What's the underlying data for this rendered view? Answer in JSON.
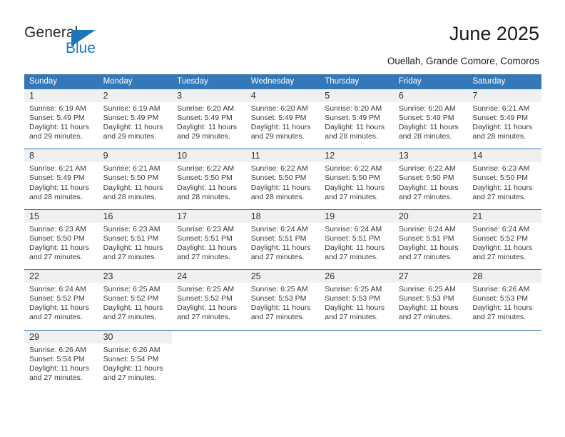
{
  "brand": {
    "name_top": "General",
    "name_bottom": "Blue",
    "accent_color": "#1c76bc",
    "triangle_icon": "brand-triangle-icon"
  },
  "header": {
    "title": "June 2025",
    "subtitle": "Ouellah, Grande Comore, Comoros"
  },
  "calendar": {
    "header_bg": "#3478b8",
    "header_text_color": "#ffffff",
    "daynum_bg": "#f0f0f0",
    "weekday_headers": [
      "Sunday",
      "Monday",
      "Tuesday",
      "Wednesday",
      "Thursday",
      "Friday",
      "Saturday"
    ],
    "weeks": [
      {
        "days": [
          {
            "date": "1",
            "sunrise": "Sunrise: 6:19 AM",
            "sunset": "Sunset: 5:49 PM",
            "daylight_1": "Daylight: 11 hours",
            "daylight_2": "and 29 minutes."
          },
          {
            "date": "2",
            "sunrise": "Sunrise: 6:19 AM",
            "sunset": "Sunset: 5:49 PM",
            "daylight_1": "Daylight: 11 hours",
            "daylight_2": "and 29 minutes."
          },
          {
            "date": "3",
            "sunrise": "Sunrise: 6:20 AM",
            "sunset": "Sunset: 5:49 PM",
            "daylight_1": "Daylight: 11 hours",
            "daylight_2": "and 29 minutes."
          },
          {
            "date": "4",
            "sunrise": "Sunrise: 6:20 AM",
            "sunset": "Sunset: 5:49 PM",
            "daylight_1": "Daylight: 11 hours",
            "daylight_2": "and 29 minutes."
          },
          {
            "date": "5",
            "sunrise": "Sunrise: 6:20 AM",
            "sunset": "Sunset: 5:49 PM",
            "daylight_1": "Daylight: 11 hours",
            "daylight_2": "and 28 minutes."
          },
          {
            "date": "6",
            "sunrise": "Sunrise: 6:20 AM",
            "sunset": "Sunset: 5:49 PM",
            "daylight_1": "Daylight: 11 hours",
            "daylight_2": "and 28 minutes."
          },
          {
            "date": "7",
            "sunrise": "Sunrise: 6:21 AM",
            "sunset": "Sunset: 5:49 PM",
            "daylight_1": "Daylight: 11 hours",
            "daylight_2": "and 28 minutes."
          }
        ]
      },
      {
        "days": [
          {
            "date": "8",
            "sunrise": "Sunrise: 6:21 AM",
            "sunset": "Sunset: 5:49 PM",
            "daylight_1": "Daylight: 11 hours",
            "daylight_2": "and 28 minutes."
          },
          {
            "date": "9",
            "sunrise": "Sunrise: 6:21 AM",
            "sunset": "Sunset: 5:50 PM",
            "daylight_1": "Daylight: 11 hours",
            "daylight_2": "and 28 minutes."
          },
          {
            "date": "10",
            "sunrise": "Sunrise: 6:22 AM",
            "sunset": "Sunset: 5:50 PM",
            "daylight_1": "Daylight: 11 hours",
            "daylight_2": "and 28 minutes."
          },
          {
            "date": "11",
            "sunrise": "Sunrise: 6:22 AM",
            "sunset": "Sunset: 5:50 PM",
            "daylight_1": "Daylight: 11 hours",
            "daylight_2": "and 28 minutes."
          },
          {
            "date": "12",
            "sunrise": "Sunrise: 6:22 AM",
            "sunset": "Sunset: 5:50 PM",
            "daylight_1": "Daylight: 11 hours",
            "daylight_2": "and 27 minutes."
          },
          {
            "date": "13",
            "sunrise": "Sunrise: 6:22 AM",
            "sunset": "Sunset: 5:50 PM",
            "daylight_1": "Daylight: 11 hours",
            "daylight_2": "and 27 minutes."
          },
          {
            "date": "14",
            "sunrise": "Sunrise: 6:23 AM",
            "sunset": "Sunset: 5:50 PM",
            "daylight_1": "Daylight: 11 hours",
            "daylight_2": "and 27 minutes."
          }
        ]
      },
      {
        "days": [
          {
            "date": "15",
            "sunrise": "Sunrise: 6:23 AM",
            "sunset": "Sunset: 5:50 PM",
            "daylight_1": "Daylight: 11 hours",
            "daylight_2": "and 27 minutes."
          },
          {
            "date": "16",
            "sunrise": "Sunrise: 6:23 AM",
            "sunset": "Sunset: 5:51 PM",
            "daylight_1": "Daylight: 11 hours",
            "daylight_2": "and 27 minutes."
          },
          {
            "date": "17",
            "sunrise": "Sunrise: 6:23 AM",
            "sunset": "Sunset: 5:51 PM",
            "daylight_1": "Daylight: 11 hours",
            "daylight_2": "and 27 minutes."
          },
          {
            "date": "18",
            "sunrise": "Sunrise: 6:24 AM",
            "sunset": "Sunset: 5:51 PM",
            "daylight_1": "Daylight: 11 hours",
            "daylight_2": "and 27 minutes."
          },
          {
            "date": "19",
            "sunrise": "Sunrise: 6:24 AM",
            "sunset": "Sunset: 5:51 PM",
            "daylight_1": "Daylight: 11 hours",
            "daylight_2": "and 27 minutes."
          },
          {
            "date": "20",
            "sunrise": "Sunrise: 6:24 AM",
            "sunset": "Sunset: 5:51 PM",
            "daylight_1": "Daylight: 11 hours",
            "daylight_2": "and 27 minutes."
          },
          {
            "date": "21",
            "sunrise": "Sunrise: 6:24 AM",
            "sunset": "Sunset: 5:52 PM",
            "daylight_1": "Daylight: 11 hours",
            "daylight_2": "and 27 minutes."
          }
        ]
      },
      {
        "days": [
          {
            "date": "22",
            "sunrise": "Sunrise: 6:24 AM",
            "sunset": "Sunset: 5:52 PM",
            "daylight_1": "Daylight: 11 hours",
            "daylight_2": "and 27 minutes."
          },
          {
            "date": "23",
            "sunrise": "Sunrise: 6:25 AM",
            "sunset": "Sunset: 5:52 PM",
            "daylight_1": "Daylight: 11 hours",
            "daylight_2": "and 27 minutes."
          },
          {
            "date": "24",
            "sunrise": "Sunrise: 6:25 AM",
            "sunset": "Sunset: 5:52 PM",
            "daylight_1": "Daylight: 11 hours",
            "daylight_2": "and 27 minutes."
          },
          {
            "date": "25",
            "sunrise": "Sunrise: 6:25 AM",
            "sunset": "Sunset: 5:53 PM",
            "daylight_1": "Daylight: 11 hours",
            "daylight_2": "and 27 minutes."
          },
          {
            "date": "26",
            "sunrise": "Sunrise: 6:25 AM",
            "sunset": "Sunset: 5:53 PM",
            "daylight_1": "Daylight: 11 hours",
            "daylight_2": "and 27 minutes."
          },
          {
            "date": "27",
            "sunrise": "Sunrise: 6:25 AM",
            "sunset": "Sunset: 5:53 PM",
            "daylight_1": "Daylight: 11 hours",
            "daylight_2": "and 27 minutes."
          },
          {
            "date": "28",
            "sunrise": "Sunrise: 6:26 AM",
            "sunset": "Sunset: 5:53 PM",
            "daylight_1": "Daylight: 11 hours",
            "daylight_2": "and 27 minutes."
          }
        ]
      },
      {
        "days": [
          {
            "date": "29",
            "sunrise": "Sunrise: 6:26 AM",
            "sunset": "Sunset: 5:54 PM",
            "daylight_1": "Daylight: 11 hours",
            "daylight_2": "and 27 minutes."
          },
          {
            "date": "30",
            "sunrise": "Sunrise: 6:26 AM",
            "sunset": "Sunset: 5:54 PM",
            "daylight_1": "Daylight: 11 hours",
            "daylight_2": "and 27 minutes."
          },
          {
            "date": "",
            "sunrise": "",
            "sunset": "",
            "daylight_1": "",
            "daylight_2": ""
          },
          {
            "date": "",
            "sunrise": "",
            "sunset": "",
            "daylight_1": "",
            "daylight_2": ""
          },
          {
            "date": "",
            "sunrise": "",
            "sunset": "",
            "daylight_1": "",
            "daylight_2": ""
          },
          {
            "date": "",
            "sunrise": "",
            "sunset": "",
            "daylight_1": "",
            "daylight_2": ""
          },
          {
            "date": "",
            "sunrise": "",
            "sunset": "",
            "daylight_1": "",
            "daylight_2": ""
          }
        ]
      }
    ]
  }
}
